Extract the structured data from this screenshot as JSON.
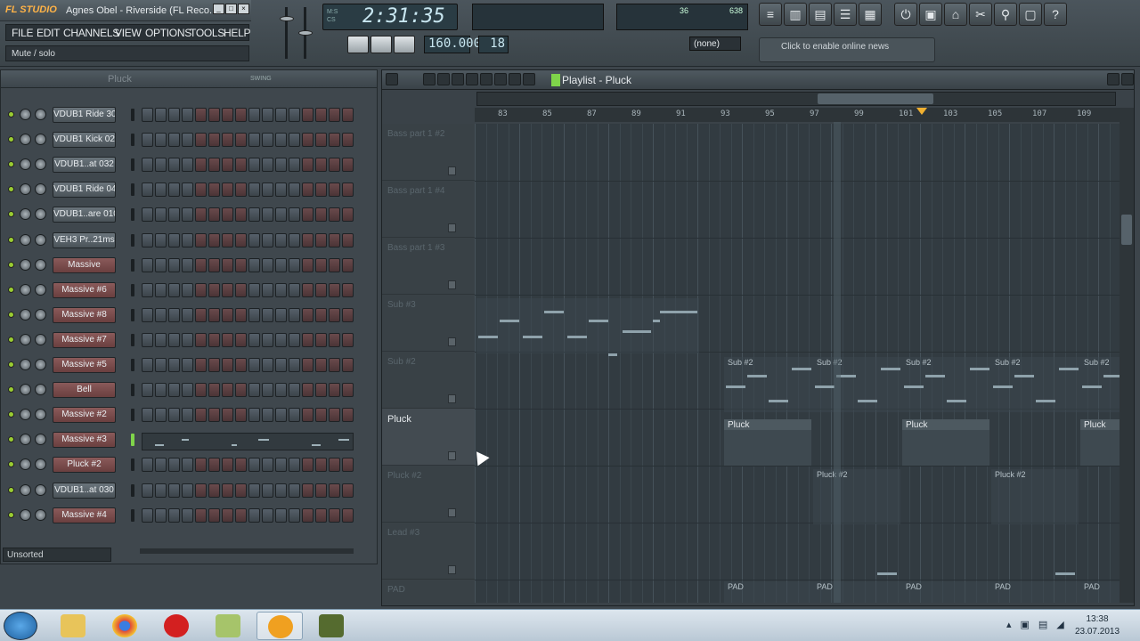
{
  "window": {
    "logo": "FL STUDIO",
    "title": "Agnes Obel - Riverside (FL Reco..."
  },
  "menu": [
    "FILE",
    "EDIT",
    "CHANNELS",
    "VIEW",
    "OPTIONS",
    "TOOLS",
    "HELP"
  ],
  "hint": "Mute / solo",
  "transport": {
    "time": "2:31:35",
    "tempo": "160.000",
    "pattern": "18",
    "pattern_select": "(none)",
    "cpu": "36",
    "ram": "638"
  },
  "news": "Click to enable online news",
  "channel_rack": {
    "title": "Pluck",
    "swing_label": "SWING",
    "filter": "Unsorted",
    "channels": [
      {
        "name": "VDUB1 Ride 30",
        "style": "grey"
      },
      {
        "name": "VDUB1 Kick 020",
        "style": "grey"
      },
      {
        "name": "VDUB1..at 032",
        "style": "grey"
      },
      {
        "name": "VDUB1 Ride 04",
        "style": "grey"
      },
      {
        "name": "VDUB1..are 010",
        "style": "grey"
      },
      {
        "name": "VEH3 Pr..21ms",
        "style": "grey"
      },
      {
        "name": "Massive",
        "style": "red"
      },
      {
        "name": "Massive #6",
        "style": "red"
      },
      {
        "name": "Massive #8",
        "style": "red"
      },
      {
        "name": "Massive #7",
        "style": "red"
      },
      {
        "name": "Massive #5",
        "style": "red"
      },
      {
        "name": "Bell",
        "style": "red"
      },
      {
        "name": "Massive #2",
        "style": "red"
      },
      {
        "name": "Massive #3",
        "style": "red"
      },
      {
        "name": "Pluck #2",
        "style": "red"
      },
      {
        "name": "VDUB1..at 030",
        "style": "grey"
      },
      {
        "name": "Massive #4",
        "style": "red"
      }
    ]
  },
  "playlist": {
    "title": "Playlist - Pluck",
    "ruler": [
      "83",
      "85",
      "87",
      "89",
      "91",
      "93",
      "95",
      "97",
      "99",
      "101",
      "103",
      "105",
      "107",
      "109"
    ],
    "tracks": [
      "Bass part 1 #2",
      "Bass part 1 #4",
      "Bass part 1 #3",
      "Sub #3",
      "Sub #2",
      "Pluck",
      "Pluck #2",
      "Lead #3",
      "PAD"
    ],
    "clips": {
      "sub2": "Sub #2",
      "pluck": "Pluck",
      "pluck2": "Pluck #2",
      "pad": "PAD"
    }
  },
  "taskbar": {
    "time": "13:38",
    "date": "23.07.2013"
  }
}
